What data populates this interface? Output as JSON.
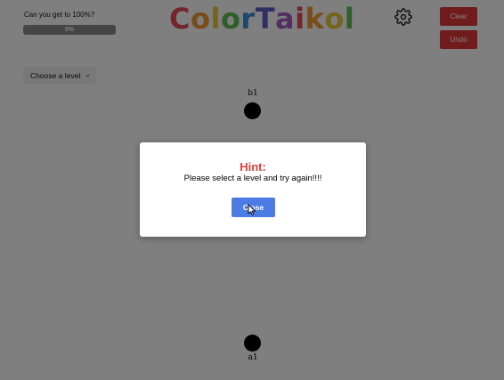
{
  "progress": {
    "label": "Can you get to 100%?",
    "percent_text": "0%",
    "value": 0
  },
  "logo": {
    "text": "ColorTaikol",
    "letters": [
      {
        "char": "C",
        "color": "#e94a57"
      },
      {
        "char": "o",
        "color": "#f29a2e"
      },
      {
        "char": "l",
        "color": "#e8c93c"
      },
      {
        "char": "o",
        "color": "#5cbc52"
      },
      {
        "char": "r",
        "color": "#3b8fd6"
      },
      {
        "char": "T",
        "color": "#5f5fc4"
      },
      {
        "char": "a",
        "color": "#a45fbf"
      },
      {
        "char": "i",
        "color": "#e94a57"
      },
      {
        "char": "k",
        "color": "#f29a2e"
      },
      {
        "char": "o",
        "color": "#e8c93c"
      },
      {
        "char": "l",
        "color": "#5cbc52"
      }
    ]
  },
  "toolbar": {
    "settings_icon": "gear-icon",
    "clear_label": "Clear",
    "undo_label": "Undo",
    "accent_red": "#e0393a"
  },
  "level_select": {
    "selected": "Choose a level",
    "chevron": "⌄"
  },
  "graph": {
    "nodes": [
      {
        "id": "b1",
        "label": "b1"
      },
      {
        "id": "a1",
        "label": "a1"
      }
    ]
  },
  "modal": {
    "title": "Hint:",
    "message": "Please select a level and try again!!!!",
    "close_label": "Close",
    "title_color": "#d9403b",
    "button_color": "#4c7ce3"
  }
}
